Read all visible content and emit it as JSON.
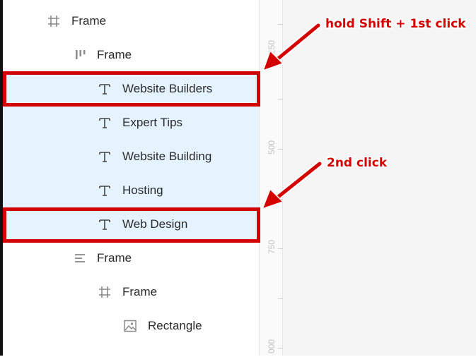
{
  "layers": [
    {
      "label": "Frame",
      "icon": "hash-frame-icon",
      "selected": false
    },
    {
      "label": "Frame",
      "icon": "auto-layout-icon",
      "selected": false
    },
    {
      "label": "Website Builders",
      "icon": "text-icon",
      "selected": true
    },
    {
      "label": "Expert Tips",
      "icon": "text-icon",
      "selected": true
    },
    {
      "label": "Website Building",
      "icon": "text-icon",
      "selected": true
    },
    {
      "label": "Hosting",
      "icon": "text-icon",
      "selected": true
    },
    {
      "label": "Web Design",
      "icon": "text-icon",
      "selected": true
    },
    {
      "label": "Frame",
      "icon": "align-left-icon",
      "selected": false
    },
    {
      "label": "Frame",
      "icon": "hash-frame-icon",
      "selected": false
    },
    {
      "label": "Rectangle",
      "icon": "image-icon",
      "selected": false
    }
  ],
  "ruler": {
    "labels": [
      "250",
      "500",
      "750",
      "000"
    ]
  },
  "annotations": {
    "first": "hold Shift + 1st click",
    "second": "2nd click"
  },
  "colors": {
    "selection": "#e5f3fe",
    "annotation": "#d40000"
  }
}
